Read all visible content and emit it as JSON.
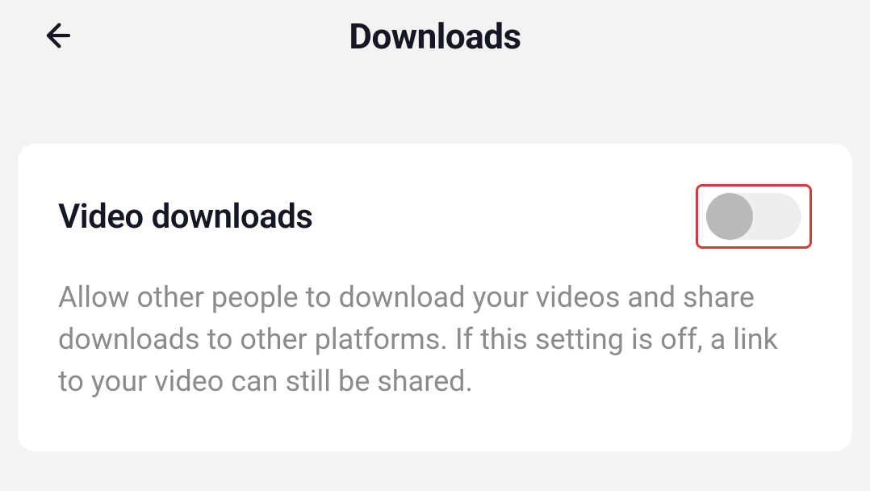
{
  "header": {
    "title": "Downloads"
  },
  "settings": {
    "video_downloads": {
      "label": "Video downloads",
      "description": "Allow other people to download your videos and share downloads to other platforms. If this setting is off, a link to your video can still be shared.",
      "enabled": false
    }
  },
  "annotation": {
    "highlight_color": "#d73a3a"
  }
}
